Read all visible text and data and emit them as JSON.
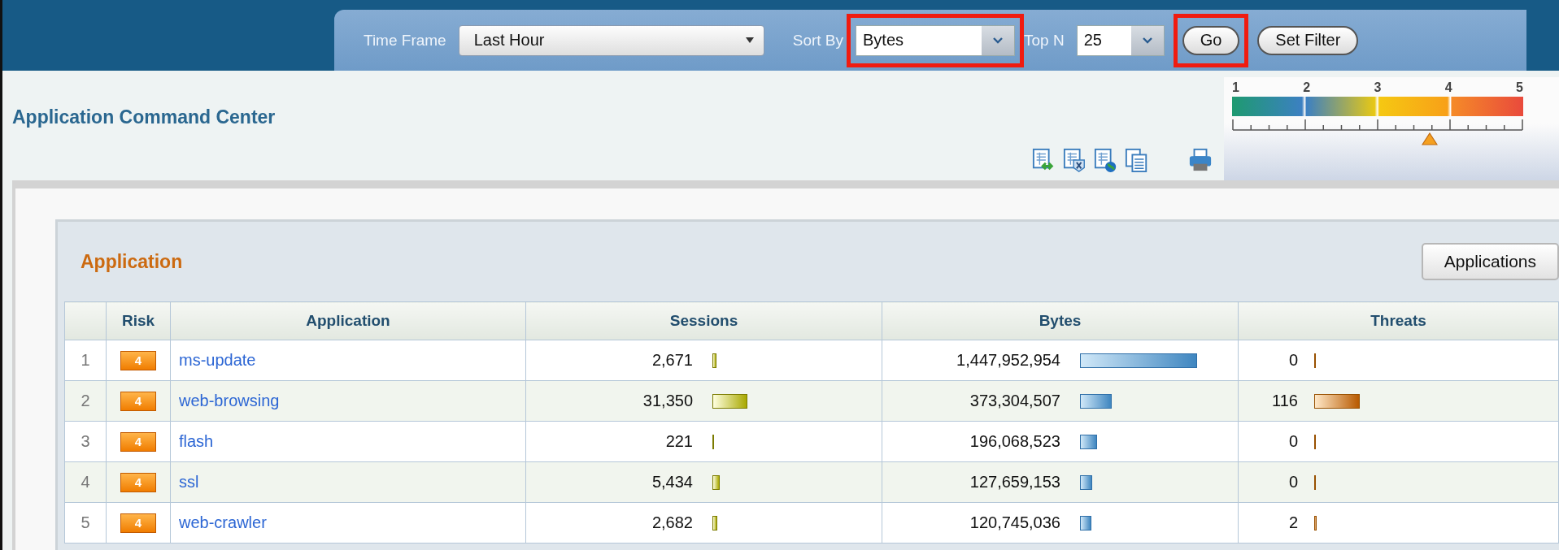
{
  "toolbar": {
    "time_frame": {
      "label": "Time Frame",
      "value": "Last Hour",
      "highlighted": false
    },
    "sort_by": {
      "label": "Sort By",
      "value": "Bytes",
      "highlighted": true
    },
    "top_n": {
      "label": "Top N",
      "value": "25",
      "highlighted": false
    },
    "buttons": [
      {
        "label": "Go",
        "highlighted": true
      },
      {
        "label": "Set Filter",
        "highlighted": false
      }
    ]
  },
  "page_title": "Application Command Center",
  "risk_meter": {
    "scale": [
      "1",
      "2",
      "3",
      "4",
      "5"
    ],
    "level": 0.69
  },
  "panel": {
    "title": "Application",
    "button": "Applications",
    "table": {
      "columns": [
        "Risk",
        "Application",
        "Sessions",
        "Bytes",
        "Threats"
      ],
      "rows": [
        {
          "index": "1",
          "risk": "4",
          "application": "ms-update",
          "sessions": {
            "value": "2,671"
          },
          "bytes": {
            "value": "1,447,952,954"
          },
          "threats": {
            "value": "0"
          }
        },
        {
          "index": "2",
          "risk": "4",
          "application": "web-browsing",
          "sessions": {
            "value": "31,350"
          },
          "bytes": {
            "value": "373,304,507"
          },
          "threats": {
            "value": "116"
          }
        },
        {
          "index": "3",
          "risk": "4",
          "application": "flash",
          "sessions": {
            "value": "221"
          },
          "bytes": {
            "value": "196,068,523"
          },
          "threats": {
            "value": "0"
          }
        },
        {
          "index": "4",
          "risk": "4",
          "application": "ssl",
          "sessions": {
            "value": "5,434"
          },
          "bytes": {
            "value": "127,659,153"
          },
          "threats": {
            "value": "0"
          }
        },
        {
          "index": "5",
          "risk": "4",
          "application": "web-crawler",
          "sessions": {
            "value": "2,682"
          },
          "bytes": {
            "value": "120,745,036"
          },
          "threats": {
            "value": "2"
          }
        }
      ]
    }
  }
}
